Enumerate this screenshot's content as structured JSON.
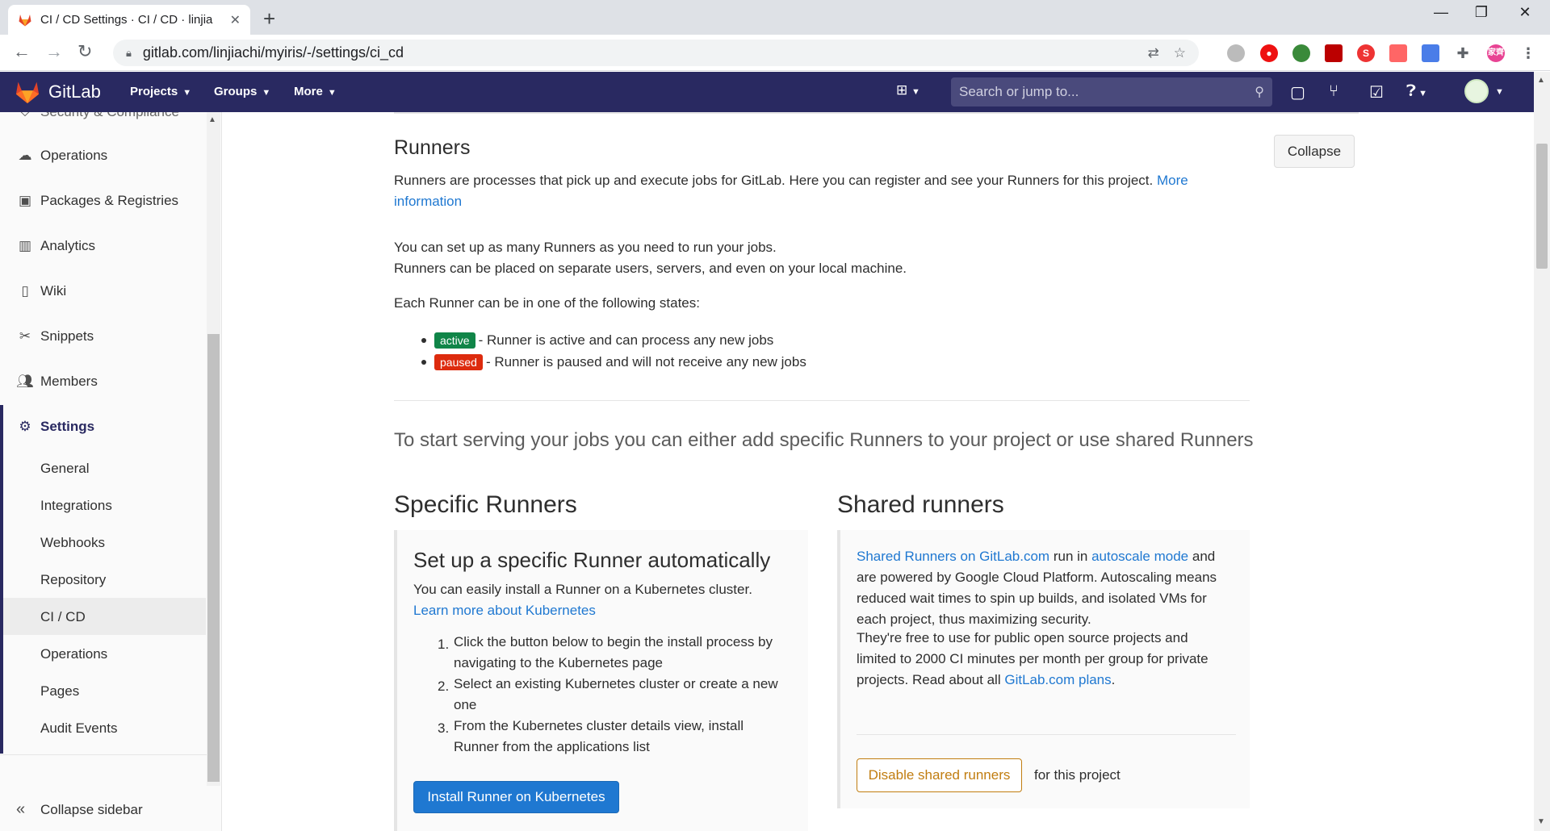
{
  "browser": {
    "tab_title": "CI / CD Settings · CI / CD · linjia",
    "url": "gitlab.com/linjiachi/myiris/-/settings/ci_cd",
    "profile_initials": "家齊"
  },
  "navbar": {
    "brand": "GitLab",
    "menus": [
      "Projects",
      "Groups",
      "More"
    ],
    "search_placeholder": "Search or jump to..."
  },
  "sidebar": {
    "partial_top": "Security & Compliance",
    "items": [
      "Operations",
      "Packages & Registries",
      "Analytics",
      "Wiki",
      "Snippets",
      "Members",
      "Settings"
    ],
    "settings_sub": [
      "General",
      "Integrations",
      "Webhooks",
      "Repository",
      "CI / CD",
      "Operations",
      "Pages",
      "Audit Events"
    ],
    "active_sub": "CI / CD",
    "collapse_label": "Collapse sidebar"
  },
  "runners": {
    "title": "Runners",
    "collapse_button": "Collapse",
    "intro": "Runners are processes that pick up and execute jobs for GitLab. Here you can register and see your Runners for this project.",
    "intro_link_1": "More",
    "intro_link_2": "information",
    "para1_line1": "You can set up as many Runners as you need to run your jobs.",
    "para1_line2": "Runners can be placed on separate users, servers, and even on your local machine.",
    "states_intro": "Each Runner can be in one of the following states:",
    "state_active_badge": "active",
    "state_active_text": "- Runner is active and can process any new jobs",
    "state_paused_badge": "paused",
    "state_paused_text": "- Runner is paused and will not receive any new jobs",
    "lead": "To start serving your jobs you can either add specific Runners to your project or use shared Runners"
  },
  "specific": {
    "heading": "Specific Runners",
    "box_title": "Set up a specific Runner automatically",
    "desc": "You can easily install a Runner on a Kubernetes cluster.",
    "learn_link": "Learn more about Kubernetes",
    "steps": [
      [
        "1.",
        "Click the button below to begin the install process by",
        "navigating to the Kubernetes page"
      ],
      [
        "2.",
        "Select an existing Kubernetes cluster or create a new",
        "one"
      ],
      [
        "3.",
        "From the Kubernetes cluster details view, install",
        "Runner from the applications list"
      ]
    ],
    "install_button": "Install Runner on Kubernetes"
  },
  "shared": {
    "heading": "Shared runners",
    "link_gitlab": "Shared Runners on GitLab.com",
    "text_run_in": "run in",
    "link_autoscale": "autoscale mode",
    "text_and": "and",
    "line2": "are powered by Google Cloud Platform. Autoscaling means",
    "line3": "reduced wait times to spin up builds, and isolated VMs for",
    "line4": "each project, thus maximizing security.",
    "p2_line1": "They're free to use for public open source projects and",
    "p2_line2": "limited to 2000 CI minutes per month per group for private",
    "p2_line3": "projects. Read about all",
    "link_plans": "GitLab.com plans",
    "p2_end": ".",
    "disable_button": "Disable shared runners",
    "for_project": "for this project"
  },
  "colors": {
    "nav": "#292961",
    "link": "#1f78d1",
    "active_badge": "#108548",
    "paused_badge": "#dd2b0e",
    "warn": "#c17d10"
  }
}
